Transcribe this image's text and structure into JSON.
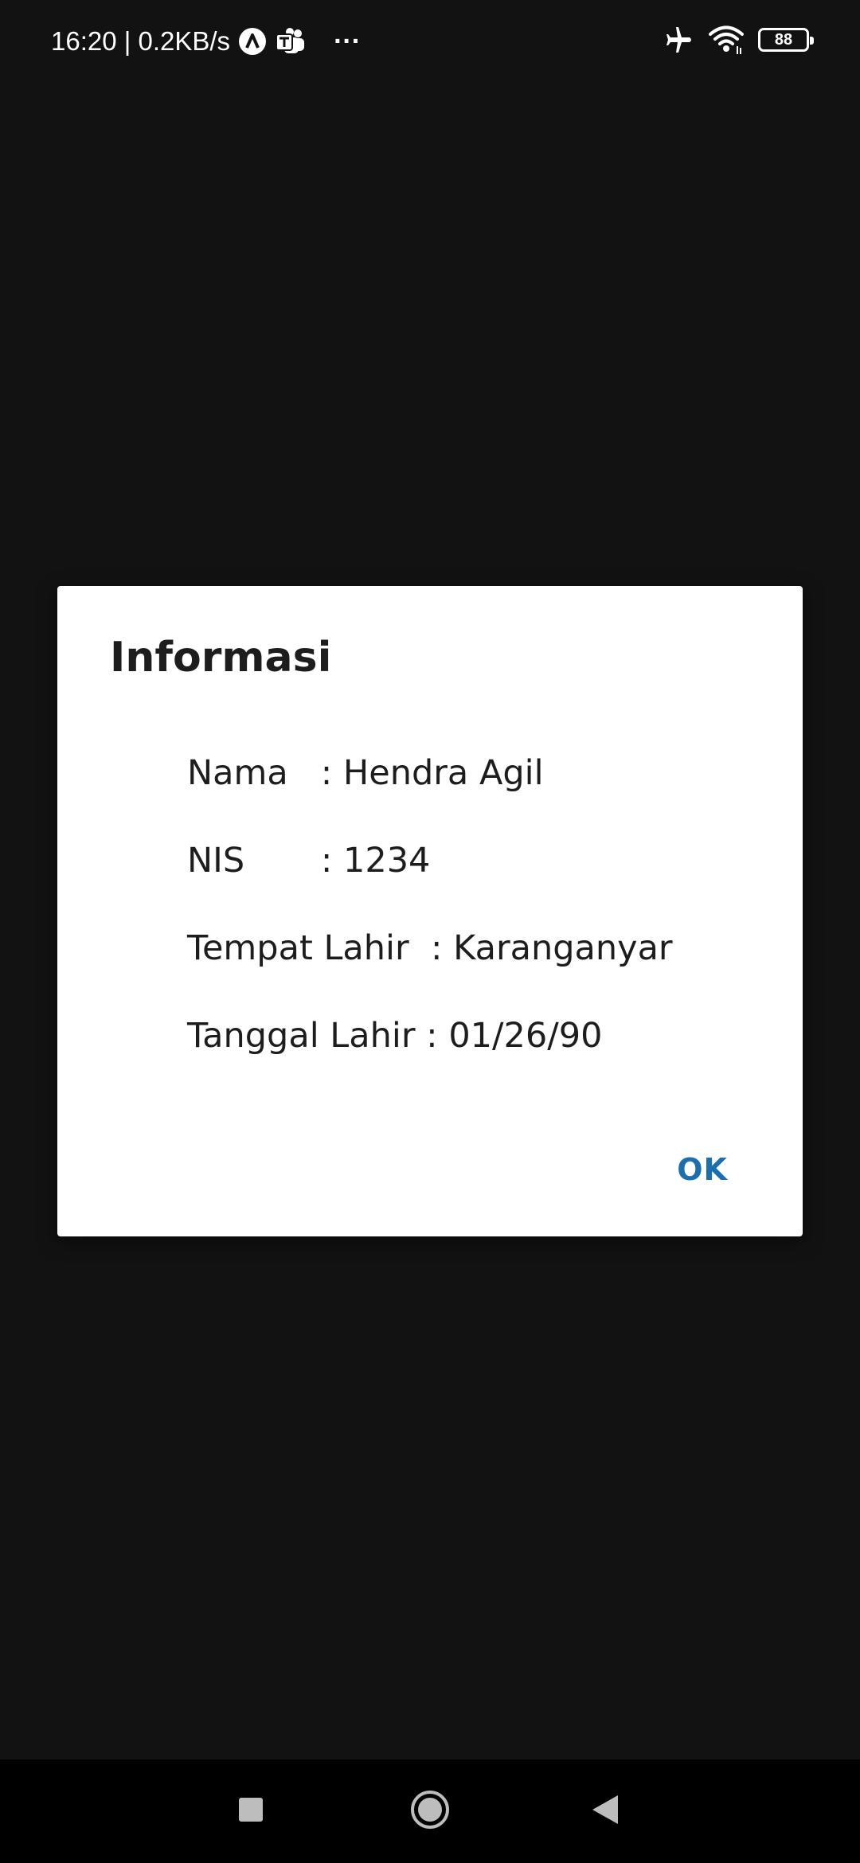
{
  "status_bar": {
    "time_speed": "16:20 | 0.2KB/s",
    "more": "···",
    "battery_level": "88",
    "icons": [
      "app-a-icon",
      "teams-icon",
      "airplane-mode-icon",
      "wifi-icon",
      "battery-icon"
    ]
  },
  "dialog": {
    "title": "Informasi",
    "rows": [
      "Nama   : Hendra Agil",
      "NIS       : 1234",
      "Tempat Lahir  : Karanganyar",
      "Tanggal Lahir : 01/26/90"
    ],
    "ok_label": "OK"
  },
  "navigation": {
    "icons": [
      "recents-icon",
      "home-icon",
      "back-icon"
    ]
  },
  "colors": {
    "background": "#121212",
    "dialog": "#ffffff",
    "accent": "#1b6fae",
    "text": "#1d1d1d",
    "nav_bar": "#000000"
  }
}
